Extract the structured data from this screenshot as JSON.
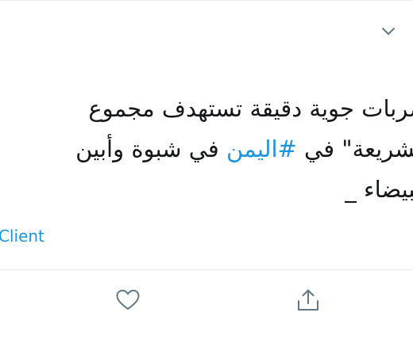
{
  "tweet": {
    "lines": [
      {
        "text": "ضربات جوية دقيقة تستهدف مجموع"
      },
      {
        "before": "الشريعة\" في ",
        "hashtag": "#اليمن",
        "after": "  في شبوة وأبين"
      },
      {
        "text": "البيضاء _"
      }
    ],
    "source": "Client"
  },
  "icons": {
    "menu": "chevron-down-icon",
    "like": "heart-icon",
    "share": "share-icon"
  },
  "colors": {
    "text": "#14171a",
    "link": "#1b95e0",
    "icon": "#657786",
    "divider": "#e6ecf0"
  }
}
